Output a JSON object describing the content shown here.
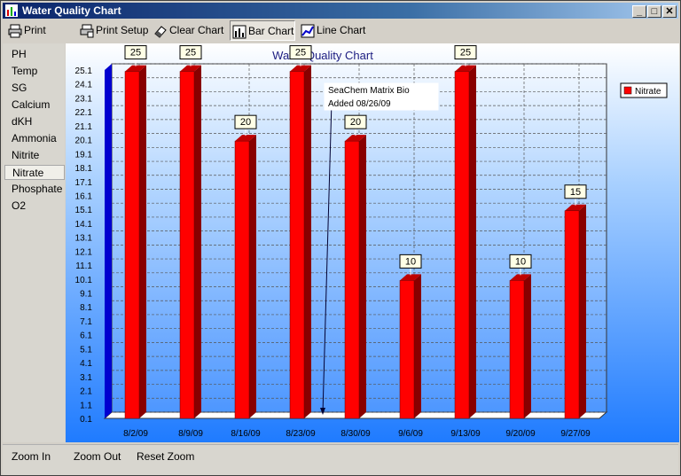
{
  "window": {
    "title": "Water Quality Chart",
    "minimize": "_",
    "maximize": "□",
    "close": "✕"
  },
  "toolbar": {
    "print": "Print",
    "print_setup": "Print Setup",
    "clear_chart": "Clear Chart",
    "bar_chart": "Bar Chart",
    "line_chart": "Line Chart"
  },
  "sidebar": {
    "items": [
      {
        "label": "PH"
      },
      {
        "label": "Temp"
      },
      {
        "label": "SG"
      },
      {
        "label": "Calcium"
      },
      {
        "label": "dKH"
      },
      {
        "label": "Ammonia"
      },
      {
        "label": "Nitrite"
      },
      {
        "label": "Nitrate",
        "active": true
      },
      {
        "label": "Phosphate"
      },
      {
        "label": "O2"
      }
    ]
  },
  "bottom": {
    "zoom_in": "Zoom In",
    "zoom_out": "Zoom Out",
    "reset_zoom": "Reset Zoom"
  },
  "colors": {
    "bar_front": "#ff0000",
    "bar_side": "#880000",
    "bar_top": "#c00000",
    "plot_bg_top": "#ffffff",
    "plot_bg_bottom": "#1f7bff",
    "title_color": "#1c1c80"
  },
  "chart_data": {
    "type": "bar",
    "title": "Water Quality Chart",
    "categories": [
      "8/2/09",
      "8/9/09",
      "8/16/09",
      "8/23/09",
      "8/30/09",
      "9/6/09",
      "9/13/09",
      "9/20/09",
      "9/27/09"
    ],
    "series": [
      {
        "name": "Nitrate",
        "values": [
          25,
          25,
          20,
          25,
          20,
          10,
          25,
          10,
          15
        ]
      }
    ],
    "y_ticks": [
      "0.1",
      "1.1",
      "2.1",
      "3.1",
      "4.1",
      "5.1",
      "6.1",
      "7.1",
      "8.1",
      "9.1",
      "10.1",
      "11.1",
      "12.1",
      "13.1",
      "14.1",
      "15.1",
      "16.1",
      "17.1",
      "18.1",
      "19.1",
      "20.1",
      "21.1",
      "22.1",
      "23.1",
      "24.1",
      "25.1"
    ],
    "ylim": [
      0.1,
      25.1
    ],
    "grid": true,
    "legend": "top-right",
    "annotation": {
      "lines": [
        "SeaChem Matrix Bio",
        "Added 08/26/09"
      ]
    }
  }
}
